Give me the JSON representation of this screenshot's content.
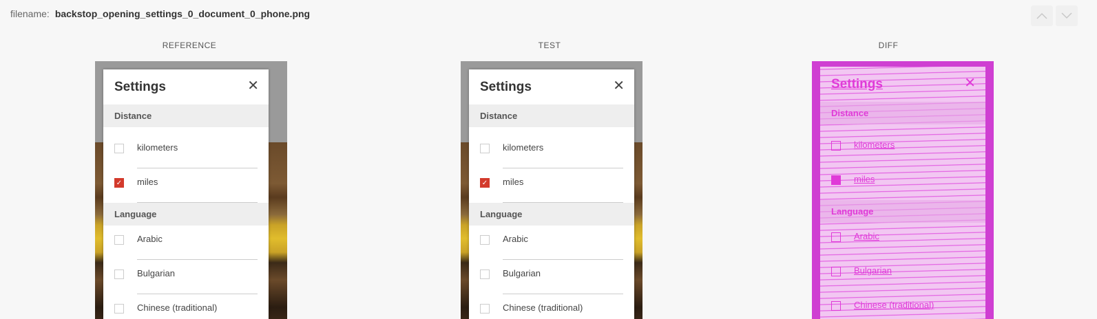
{
  "header": {
    "filename_label": "filename:",
    "filename": "backstop_opening_settings_0_document_0_phone.png"
  },
  "columns": [
    "REFERENCE",
    "TEST",
    "DIFF"
  ],
  "nav": {
    "up_icon": "chevron-up-icon",
    "down_icon": "chevron-down-icon"
  },
  "modal": {
    "title": "Settings",
    "close_glyph": "✕",
    "distance_header": "Distance",
    "distance_options": [
      {
        "label": "kilometers",
        "checked": false
      },
      {
        "label": "miles",
        "checked": true
      }
    ],
    "language_header": "Language",
    "language_options": [
      {
        "label": "Arabic",
        "checked": false
      },
      {
        "label": "Bulgarian",
        "checked": false
      },
      {
        "label": "Chinese (traditional)",
        "checked": false
      }
    ]
  },
  "colors": {
    "accent": "#d33a2c",
    "diff_magenta": "#e03ad8"
  }
}
